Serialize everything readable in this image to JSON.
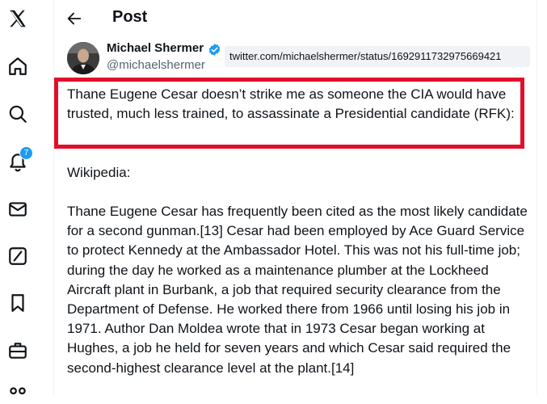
{
  "sidebar": {
    "items": [
      {
        "icon": "x-logo-icon"
      },
      {
        "icon": "home-icon"
      },
      {
        "icon": "search-icon"
      },
      {
        "icon": "bell-icon",
        "badge": "7"
      },
      {
        "icon": "mail-icon"
      },
      {
        "icon": "grok-icon"
      },
      {
        "icon": "bookmark-icon"
      },
      {
        "icon": "briefcase-icon"
      },
      {
        "icon": "communities-icon"
      }
    ]
  },
  "header": {
    "title": "Post"
  },
  "author": {
    "name": "Michael Shermer",
    "handle": "@michaelshermer",
    "verified": true
  },
  "url_overlay": "twitter.com/michaelshermer/status/1692911732975669421",
  "tweet": {
    "highlighted": "Thane Eugene Cesar doesn’t strike me as someone the CIA would have trusted, much less trained, to assassinate a Presidential candidate (RFK):",
    "source": "Wikipedia:",
    "quote": "Thane Eugene Cesar has frequently been cited as the most likely candidate for a second gunman.[13] Cesar had been employed by Ace Guard Service to protect Kennedy at the Ambassador Hotel. This was not his full-time job; during the day he worked as a maintenance plumber at the Lockheed Aircraft plant in Burbank, a job that required security clearance from the Department of Defense. He worked there from 1966 until losing his job in 1971. Author Dan Moldea wrote that in 1973 Cesar began working at Hughes, a job he held for seven years and which Cesar said required the second-highest clearance level at the plant.[14]"
  },
  "colors": {
    "accent": "#1d9bf0",
    "highlight_border": "#e0102a",
    "text": "#0f1419",
    "muted": "#536471"
  }
}
